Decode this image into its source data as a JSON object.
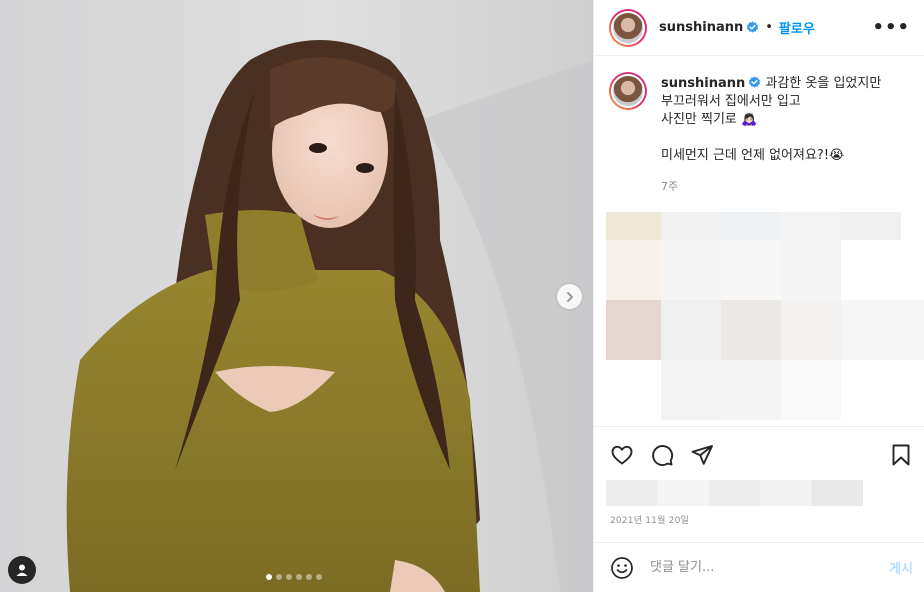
{
  "header": {
    "username": "sunshinann",
    "separator": "•",
    "follow_label": "팔로우",
    "more_label": "•••"
  },
  "caption": {
    "username": "sunshinann",
    "text": "과감한 옷을 입었지만\n부끄러워서 집에서만 입고\n사진만 찍기로 🙇🏻‍♀️\n\n미세먼지 근데 언제 없어져요?!😭",
    "time_ago": "7주"
  },
  "post": {
    "date": "2021년 11월 20일",
    "carousel_total": 6,
    "carousel_active": 1
  },
  "comment": {
    "placeholder": "댓글 달기...",
    "post_label": "게시"
  },
  "colors": {
    "link_blue": "#0095f6",
    "post_disabled": "#b2dffc",
    "sweater": "#8a7a2a"
  }
}
